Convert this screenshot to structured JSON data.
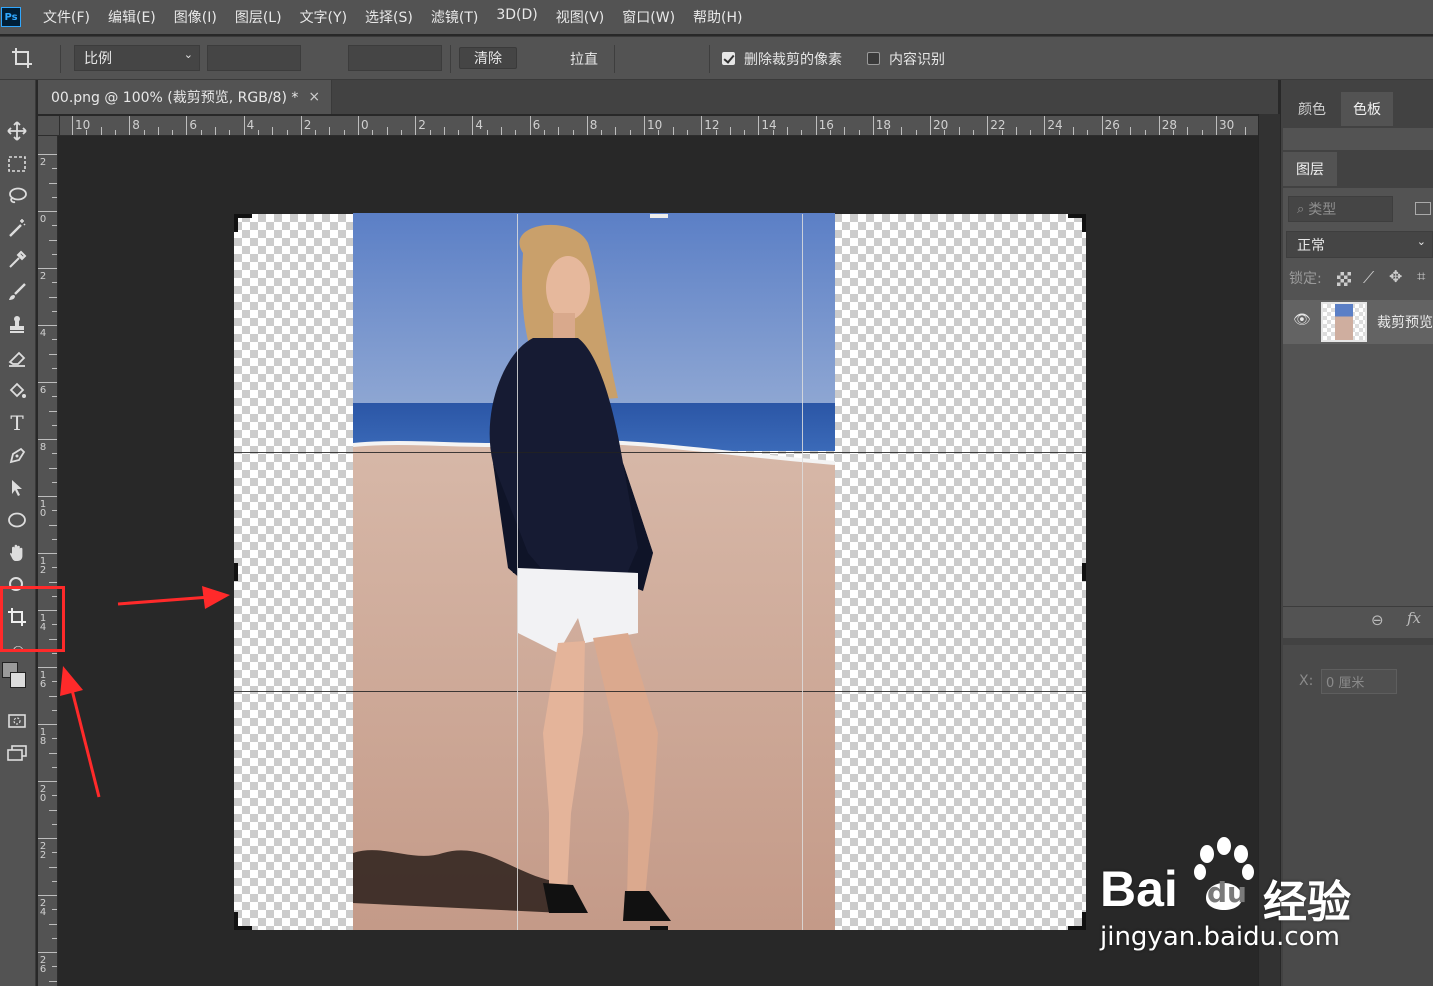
{
  "app": {
    "logo": "Ps"
  },
  "menu": [
    "文件(F)",
    "编辑(E)",
    "图像(I)",
    "图层(L)",
    "文字(Y)",
    "选择(S)",
    "滤镜(T)",
    "3D(D)",
    "视图(V)",
    "窗口(W)",
    "帮助(H)"
  ],
  "options": {
    "ratio_label": "比例",
    "clear_label": "清除",
    "straighten_label": "拉直",
    "delete_pixels_label": "删除裁剪的像素",
    "delete_pixels_checked": true,
    "content_aware_label": "内容识别",
    "content_aware_checked": false
  },
  "document": {
    "tab_title": "00.png @ 100% (裁剪预览, RGB/8) *",
    "close": "×"
  },
  "ruler_h": [
    "10",
    "8",
    "6",
    "4",
    "2",
    "0",
    "2",
    "4",
    "6",
    "8",
    "10",
    "12",
    "14",
    "16",
    "18",
    "20",
    "22",
    "24",
    "26",
    "28",
    "30"
  ],
  "ruler_v": [
    "2",
    "0",
    "2",
    "4",
    "6",
    "8",
    "10",
    "12",
    "14",
    "16",
    "18",
    "20",
    "22",
    "24",
    "26"
  ],
  "panels": {
    "color_tab": "颜色",
    "swatches_tab": "色板",
    "layers_tab": "图层",
    "filter_placeholder": "类型",
    "blend_mode": "正常",
    "lock_label": "锁定:",
    "layer_name": "裁剪预览",
    "x_label": "X:",
    "x_value": "0 厘米"
  },
  "watermark": {
    "brand": "Bai",
    "brand_du": "du",
    "cn": "经验",
    "url": "jingyan.baidu.com"
  },
  "colors": {
    "annotation": "#ff2a2a",
    "panel": "#535353",
    "canvas_bg": "#282828"
  }
}
